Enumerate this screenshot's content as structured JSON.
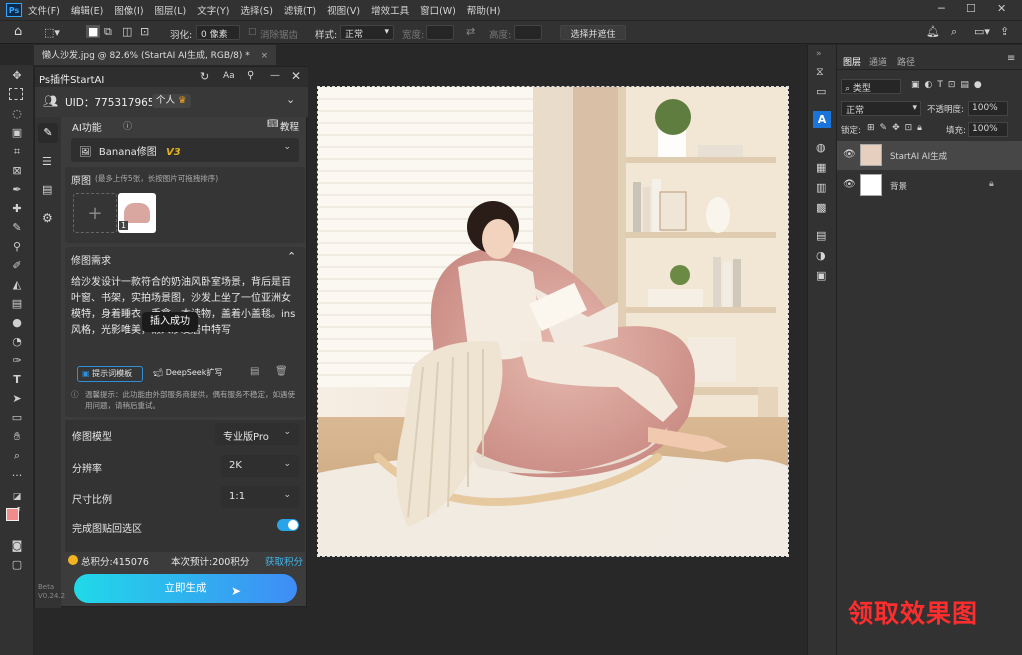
{
  "menu": {
    "app_icon": "Ps",
    "items": [
      "文件(F)",
      "编辑(E)",
      "图像(I)",
      "图层(L)",
      "文字(Y)",
      "选择(S)",
      "滤镜(T)",
      "视图(V)",
      "增效工具",
      "窗口(W)",
      "帮助(H)"
    ]
  },
  "options": {
    "feather_label": "羽化:",
    "feather_value": "0 像素",
    "antialias_label": "消除锯齿",
    "style_label": "样式:",
    "style_value": "正常",
    "width_label": "宽度:",
    "height_label": "高度:",
    "select_mask_label": "选择并遮住 ..."
  },
  "document": {
    "tab_title": "懒人沙发.jpg @ 82.6% (StartAI AI生成, RGB/8) *",
    "close_glyph": "×"
  },
  "plugin": {
    "title": "Ps插件StartAI",
    "font_btn": "Aa",
    "uid_label": "UID：775317965",
    "account_badge": "个人",
    "ai_function_label": "AI功能",
    "tutorial_label": "教程",
    "function_select": "Banana修图",
    "function_version": "V3",
    "source_label": "原图",
    "source_hint": "(最多上传5张，长按图片可拖拽排序)",
    "thumb_index": "1",
    "requirement_label": "修图需求",
    "prompt_text": "给沙发设计一款符合的奶油风卧室场景，背后是百叶窗、书架，实拍场景图，沙发上坐了一位亚洲女模特，身着睡衣，手拿一本读物，盖着小盖毯。ins风格，光影唯美，懒人沙发居中特写",
    "toast": "插入成功",
    "prompt_template_btn": "提示词模板",
    "deepseek_btn": "DeepSeek扩写",
    "notice": "温馨提示：此功能由外部服务商提供，偶有服务不稳定，如遇使用问题，请稍后重试。",
    "model_label": "修图模型",
    "model_value": "专业版Pro",
    "resolution_label": "分辨率",
    "resolution_value": "2K",
    "ratio_label": "尺寸比例",
    "ratio_value": "1:1",
    "paste_back_label": "完成图贴回选区",
    "paste_back_on": true,
    "points_total": "总积分:415076",
    "points_estimate": "本次预计:200积分",
    "get_points": "获取积分",
    "generate_btn": "立即生成",
    "version": "Beta\nV0.24.2"
  },
  "layers_panel": {
    "tabs": [
      "图层",
      "通道",
      "路径"
    ],
    "filter_kind": "类型",
    "blend_mode": "正常",
    "opacity_label": "不透明度:",
    "opacity_value": "100%",
    "lock_label": "锁定:",
    "fill_label": "填充:",
    "fill_value": "100%",
    "layers": [
      {
        "name": "StartAI AI生成"
      },
      {
        "name": "背景"
      }
    ]
  },
  "cta": "领取效果图",
  "colors": {
    "accent_cyan": "#20d9e8",
    "accent_blue": "#3f8cf6",
    "cta_red": "#ff2d2d"
  }
}
